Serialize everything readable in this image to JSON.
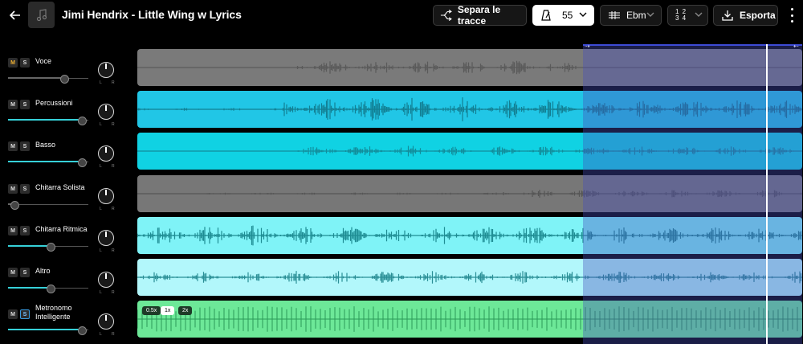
{
  "header": {
    "title": "Jimi Hendrix - Little Wing w Lyrics",
    "separate_label": "Separa le tracce",
    "tempo_value": "55",
    "key_value": "Ebm",
    "time_sig_top": "1 2",
    "time_sig_bottom": "3 4",
    "export_label": "Esporta"
  },
  "tracks": [
    {
      "name": "Voce",
      "mute": "M",
      "solo": "S",
      "volume": 0.7,
      "pan_left": "L",
      "pan_right": "R",
      "color": "#7a7a7a",
      "wave": "#5a5a5a",
      "muted": true
    },
    {
      "name": "Percussioni",
      "mute": "M",
      "solo": "S",
      "volume": 0.92,
      "pan_left": "L",
      "pan_right": "R",
      "color": "#21c6e6",
      "wave": "#127f93",
      "muted": false
    },
    {
      "name": "Basso",
      "mute": "M",
      "solo": "S",
      "volume": 0.92,
      "pan_left": "L",
      "pan_right": "R",
      "color": "#10d2e3",
      "wave": "#128d9b",
      "muted": false
    },
    {
      "name": "Chitarra Solista",
      "mute": "M",
      "solo": "S",
      "volume": 0.08,
      "pan_left": "L",
      "pan_right": "R",
      "color": "#777777",
      "wave": "#555555",
      "muted": true
    },
    {
      "name": "Chitarra Ritmica",
      "mute": "M",
      "solo": "S",
      "volume": 0.53,
      "pan_left": "L",
      "pan_right": "R",
      "color": "#7ff3f7",
      "wave": "#1e8c93",
      "muted": false
    },
    {
      "name": "Altro",
      "mute": "M",
      "solo": "S",
      "volume": 0.53,
      "pan_left": "L",
      "pan_right": "R",
      "color": "#b2f7fb",
      "wave": "#2a8f96",
      "muted": false
    },
    {
      "name": "Metronomo Intelligente",
      "mute": "M",
      "solo": "S",
      "volume": 0.92,
      "pan_left": "L",
      "pan_right": "R",
      "color": "#6de898",
      "wave": "#2a9a58",
      "muted": false
    }
  ],
  "metronome_speeds": [
    "0.5x",
    "1x",
    "2x"
  ],
  "metronome_selected_speed": "1x",
  "loop_start_marker": "⇢",
  "loop_end_marker": "⇠",
  "colors": {
    "accent": "#36d0d8",
    "loop": "#3d4bd6",
    "solo_active": "#3a9be0",
    "mute_active": "#f2b233"
  }
}
